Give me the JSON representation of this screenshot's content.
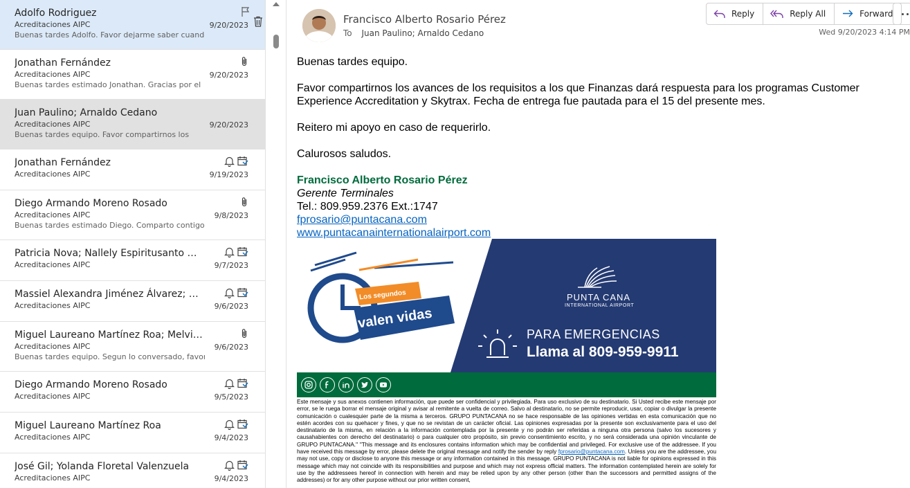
{
  "messages": [
    {
      "sender": "Adolfo Rodriguez",
      "subject": "Acreditaciones AIPC",
      "date": "9/20/2023",
      "preview": "Buenas tardes Adolfo.  Favor dejarme saber cuando"
    },
    {
      "sender": "Jonathan Fernández",
      "subject": "Acreditaciones AIPC",
      "date": "9/20/2023",
      "preview": "Buenas tardes estimado Jonathan.  Gracias por el"
    },
    {
      "sender": "Juan Paulino; Arnaldo Cedano",
      "subject": "Acreditaciones AIPC",
      "date": "9/20/2023",
      "preview": "Buenas tardes equipo.  Favor compartirnos los"
    },
    {
      "sender": "Jonathan Fernández",
      "subject": "Acreditaciones AIPC",
      "date": "9/19/2023",
      "preview": ""
    },
    {
      "sender": "Diego Armando Moreno Rosado",
      "subject": "Acreditaciones AIPC",
      "date": "9/8/2023",
      "preview": "Buenas tardes estimado Diego.  Comparto contigo"
    },
    {
      "sender": "Patricia Nova; Nallely Espiritusanto Me...",
      "subject": "Acreditaciones AIPC",
      "date": "9/7/2023",
      "preview": ""
    },
    {
      "sender": "Massiel Alexandra Jiménez Álvarez; Ya...",
      "subject": "Acreditaciones AIPC",
      "date": "9/6/2023",
      "preview": ""
    },
    {
      "sender": "Miguel Laureano Martínez Roa; Melvin...",
      "subject": "Acreditaciones AIPC",
      "date": "9/6/2023",
      "preview": "Buenas tardes equipo.  Segun lo conversado, favor"
    },
    {
      "sender": "Diego Armando Moreno Rosado",
      "subject": "Acreditaciones AIPC",
      "date": "9/5/2023",
      "preview": ""
    },
    {
      "sender": "Miguel Laureano Martínez Roa",
      "subject": "Acreditaciones AIPC",
      "date": "9/4/2023",
      "preview": ""
    },
    {
      "sender": "José Gil; Yolanda Floretal Valenzuela",
      "subject": "Acreditaciones AIPC",
      "date": "9/4/2023",
      "preview": ""
    }
  ],
  "reading": {
    "from": "Francisco Alberto Rosario Pérez",
    "to_label": "To",
    "to": "Juan Paulino; Arnaldo Cedano",
    "date": "Wed 9/20/2023 4:14 PM",
    "actions": {
      "reply": "Reply",
      "reply_all": "Reply All",
      "forward": "Forward"
    },
    "body": {
      "greeting": "Buenas tardes equipo.",
      "p1": "Favor compartirnos los avances de los requisitos  a los que Finanzas dará respuesta para los programas Customer Experience Accreditation y Skytrax. Fecha de entrega fue pautada para el 15 del presente mes.",
      "p2": "Reitero mi apoyo en caso de requerirlo.",
      "closing": "Calurosos saludos."
    },
    "signature": {
      "name": "Francisco Alberto Rosario Pérez",
      "role": "Gerente Terminales",
      "phone": "Tel.: 809.959.2376 Ext.:1747",
      "email": "fprosario@puntacana.com",
      "web": "www.puntacanainternationalairport.com"
    },
    "banner": {
      "tag_small": "Los segundos",
      "tag_big": "valen vidas",
      "brand": "PUNTA CANA",
      "brand_sub": "INTERNATIONAL AIRPORT",
      "emergency": "PARA EMERGENCIAS",
      "call": "Llama al 809-959-9911"
    },
    "disclaimer": {
      "part1": "Este mensaje y sus anexos contienen información, que puede ser confidencial y privilegiada. Para uso exclusivo de su destinatario. Si Usted recibe este mensaje por error, se le ruega borrar el mensaje original y avisar al remitente a vuelta de correo. Salvo al destinatario, no se permite reproducir, usar, copiar o divulgar la presente comunicación o cualesquier parte de la misma a terceros. GRUPO PUNTACANA no se hace responsable de las opiniones vertidas en esta comunicación que no estén acordes con su quehacer y fines, y que no se revistan de un carácter oficial. Las opiniones expresadas por la presente son exclusivamente para el uso del destinatario de la misma, en relación a la información contemplada por la presente y no podrán ser referidas a ninguna otra persona (salvo los sucesores y causahabientes con derecho del destinatario) o para cualquier otro propósito, sin previo consentimiento escrito, y no será considerada una opinión vinculante de GRUPO PUNTACANA.\" \"This message and its enclosures contains information which may be confidential and privileged. For exclusive use of the addressee. If you have received this message by error, please delete the original message and notify the sender by reply",
      "email": "fprosario@puntacana.com",
      "part2": ". Unless you are the addressee, you may not use, copy or disclose to anyone this message or any information contained in this message. GRUPO PUNTACANA is not liable for opinions expressed in this message which may not coincide with its responsibilities and purpose and which may not express official matters. The information contemplated herein are solely for use by the addressees hereof in connection with herein and may be relied upon by any other person (other than the successors and permitted assigns of the addresses) or for any other purpose without our prior written consent,"
    }
  }
}
